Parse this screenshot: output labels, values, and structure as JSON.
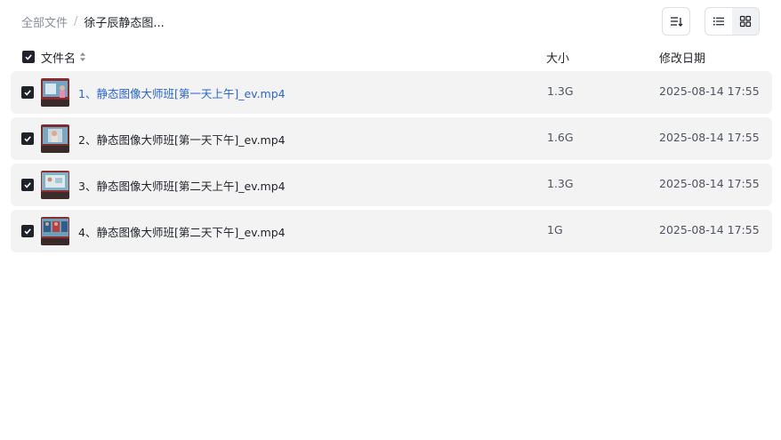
{
  "breadcrumb": {
    "root": "全部文件",
    "separator": "/",
    "current": "徐子辰静态图..."
  },
  "toolbar": {
    "sort_icon": "sort-lines-icon",
    "list_view_icon": "list-view-icon",
    "grid_view_icon": "grid-view-icon"
  },
  "table": {
    "columns": {
      "name": "文件名",
      "size": "大小",
      "date": "修改日期"
    },
    "rows": [
      {
        "name": "1、静态图像大师班[第一天上午]_ev.mp4",
        "size": "1.3G",
        "date": "2025-08-14 17:55",
        "highlighted": true
      },
      {
        "name": "2、静态图像大师班[第一天下午]_ev.mp4",
        "size": "1.6G",
        "date": "2025-08-14 17:55",
        "highlighted": false
      },
      {
        "name": "3、静态图像大师班[第二天上午]_ev.mp4",
        "size": "1.3G",
        "date": "2025-08-14 17:55",
        "highlighted": false
      },
      {
        "name": "4、静态图像大师班[第二天下午]_ev.mp4",
        "size": "1G",
        "date": "2025-08-14 17:55",
        "highlighted": false
      }
    ]
  },
  "colors": {
    "link": "#2a64d6",
    "row_bg": "#f3f3f4",
    "checkbox": "#1f2329"
  }
}
